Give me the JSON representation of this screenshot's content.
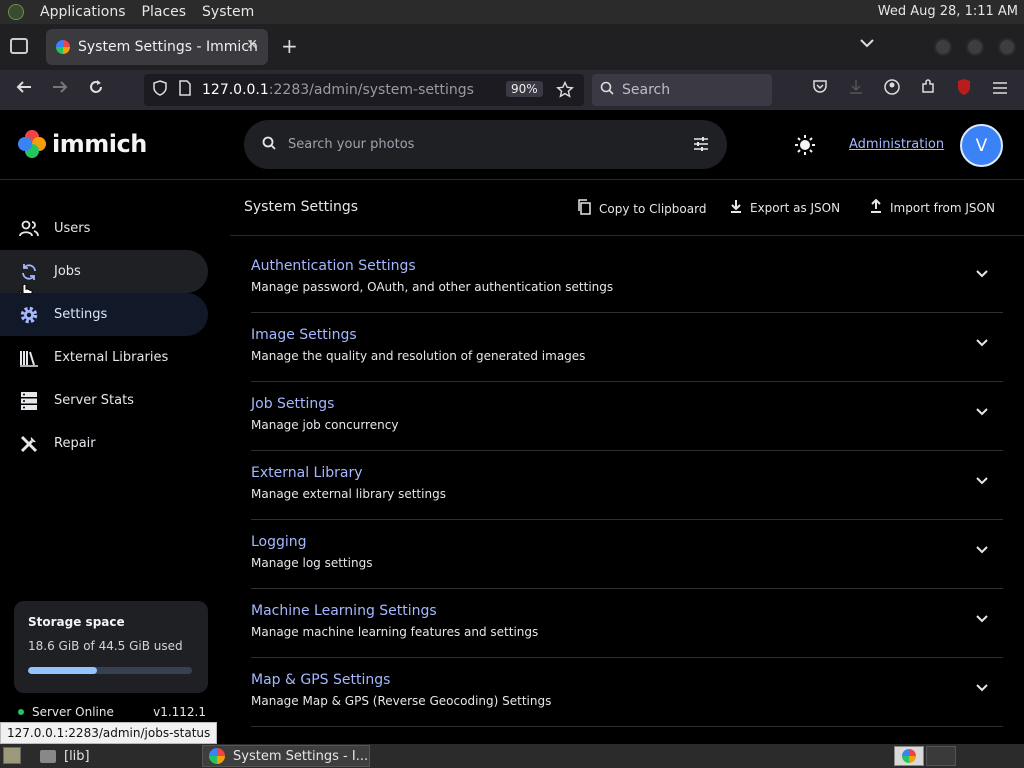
{
  "os_panel": {
    "menus": [
      "Applications",
      "Places",
      "System"
    ],
    "clock": "Wed Aug 28,  1:11 AM"
  },
  "browser": {
    "tab_title": "System Settings - Immich",
    "tab_close": "✕",
    "new_tab": "+",
    "url_host": "127.0.0.1",
    "url_path": ":2283/admin/system-settings",
    "zoom": "90%",
    "search_placeholder": "Search"
  },
  "app": {
    "logo_text": "immich",
    "search_placeholder": "Search your photos",
    "admin_link": "Administration",
    "avatar_initial": "V"
  },
  "sidebar": {
    "items": [
      {
        "label": "Users",
        "icon": "users-icon"
      },
      {
        "label": "Jobs",
        "icon": "sync-icon"
      },
      {
        "label": "Settings",
        "icon": "gear-icon"
      },
      {
        "label": "External Libraries",
        "icon": "library-icon"
      },
      {
        "label": "Server Stats",
        "icon": "server-icon"
      },
      {
        "label": "Repair",
        "icon": "tools-icon"
      }
    ],
    "storage": {
      "title": "Storage space",
      "used": "18.6 GiB of 44.5 GiB used",
      "fraction": 0.418
    },
    "server": {
      "status": "Server Online",
      "version": "v1.112.1",
      "status_color": "#22c55e"
    }
  },
  "main": {
    "title": "System Settings",
    "actions": {
      "copy": "Copy to Clipboard",
      "export": "Export as JSON",
      "import": "Import from JSON"
    },
    "sections": [
      {
        "title": "Authentication Settings",
        "desc": "Manage password, OAuth, and other authentication settings"
      },
      {
        "title": "Image Settings",
        "desc": "Manage the quality and resolution of generated images"
      },
      {
        "title": "Job Settings",
        "desc": "Manage job concurrency"
      },
      {
        "title": "External Library",
        "desc": "Manage external library settings"
      },
      {
        "title": "Logging",
        "desc": "Manage log settings"
      },
      {
        "title": "Machine Learning Settings",
        "desc": "Manage machine learning features and settings"
      },
      {
        "title": "Map & GPS Settings",
        "desc": "Manage Map & GPS (Reverse Geocoding) Settings"
      }
    ]
  },
  "status_url": "127.0.0.1:2283/admin/jobs-status",
  "taskbar": {
    "folder_task": "[lib]",
    "browser_task": "System Settings - I..."
  },
  "colors": {
    "accent": "#a5b8ff",
    "avatar": "#3b82f6",
    "storage_fill": "#93c5fd"
  }
}
